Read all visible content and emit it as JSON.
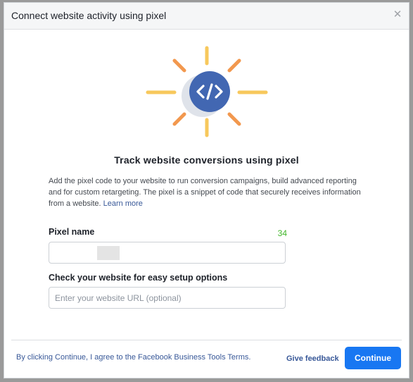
{
  "dialog": {
    "title": "Connect website activity using pixel",
    "close_icon": "close-icon",
    "illustration_icon": "code-brackets-icon",
    "colors": {
      "accent": "#4267b2",
      "ray_yellow": "#f7c85c",
      "ray_orange": "#f2984e",
      "primary_button": "#1877f2",
      "link": "#385898",
      "counter": "#42b72a"
    }
  },
  "content": {
    "heading": "Track website conversions using pixel",
    "description": "Add the pixel code to your website to run conversion campaigns, build advanced reporting and for custom retargeting. The pixel is a snippet of code that securely receives information from a website.",
    "learn_more": "Learn more"
  },
  "form": {
    "pixel_name_label": "Pixel name",
    "pixel_name_counter": "34",
    "pixel_name_value": "",
    "website_label": "Check your website for easy setup options",
    "website_placeholder": "Enter your website URL (optional)",
    "website_value": ""
  },
  "footer": {
    "terms_text": "By clicking Continue, I agree to the Facebook Business Tools Terms.",
    "feedback_label": "Give feedback",
    "continue_label": "Continue"
  }
}
